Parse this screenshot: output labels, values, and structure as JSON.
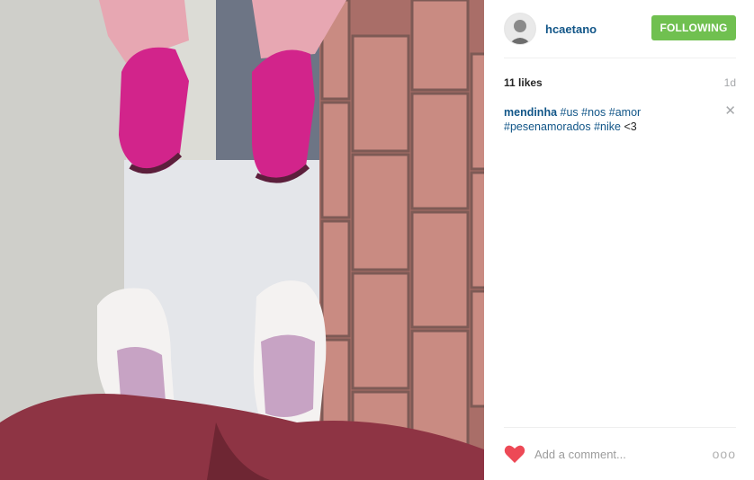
{
  "photo": {
    "icon": "photo-shoes"
  },
  "author": {
    "username": "hcaetano",
    "follow_label": "FOLLOWING",
    "follow_color": "#70c050"
  },
  "post": {
    "likes": "11 likes",
    "time_ago": "1d",
    "caption": {
      "author": "mendinha",
      "tags": [
        "#us",
        "#nos",
        "#amor",
        "#pesenamorados",
        "#nike"
      ],
      "suffix": "<3"
    }
  },
  "comment": {
    "placeholder": "Add a comment...",
    "like_color": "#ed4956",
    "more_label": "ooo"
  }
}
